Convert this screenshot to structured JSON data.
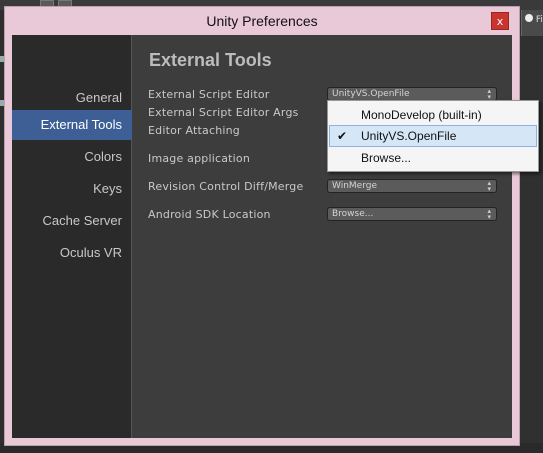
{
  "window": {
    "title": "Unity Preferences",
    "close_label": "x"
  },
  "background": {
    "right_tab_label": "Fi"
  },
  "sidebar": {
    "items": [
      {
        "label": "General",
        "active": false
      },
      {
        "label": "External Tools",
        "active": true
      },
      {
        "label": "Colors",
        "active": false
      },
      {
        "label": "Keys",
        "active": false
      },
      {
        "label": "Cache Server",
        "active": false
      },
      {
        "label": "Oculus VR",
        "active": false
      }
    ]
  },
  "content": {
    "title": "External Tools",
    "rows": {
      "script_editor_label": "External Script Editor",
      "script_editor_value": "UnityVS.OpenFile",
      "script_editor_args_label": "External Script Editor Args",
      "editor_attaching_label": "Editor Attaching",
      "image_app_label": "Image application",
      "revision_diff_label": "Revision Control Diff/Merge",
      "revision_diff_value": "WinMerge",
      "android_sdk_label": "Android SDK Location",
      "android_sdk_value": "Browse..."
    }
  },
  "popup_menu": {
    "items": [
      {
        "label": "MonoDevelop (built-in)",
        "checked": false
      },
      {
        "label": "UnityVS.OpenFile",
        "checked": true
      },
      {
        "label": "Browse...",
        "checked": false
      }
    ],
    "check_glyph": "✔"
  },
  "colors": {
    "window_frame": "#e9c9d8",
    "selected_sidebar": "#3e5f96",
    "close_button": "#c8352f",
    "menu_highlight": "#d5e6f7"
  }
}
